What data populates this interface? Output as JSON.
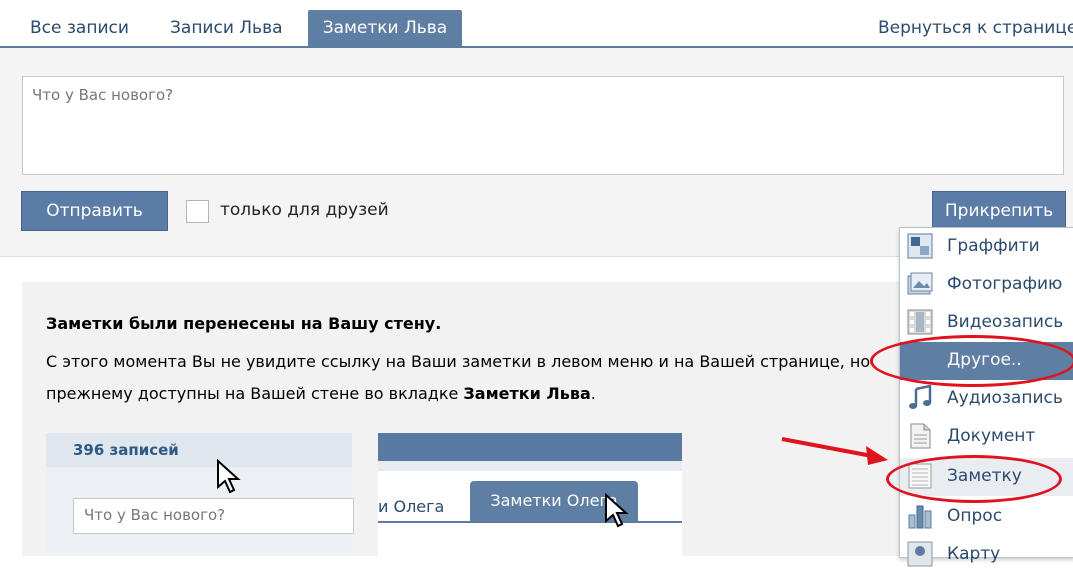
{
  "tabs": {
    "all": "Все записи",
    "lev": "Записи Льва",
    "notes": "Заметки Льва",
    "back": "Вернуться к странице"
  },
  "composer": {
    "placeholder": "Что у Вас нового?",
    "send": "Отправить",
    "friends_only": "только для друзей",
    "attach": "Прикрепить"
  },
  "notice": {
    "title": "Заметки были перенесены на Вашу стену.",
    "line1": "С этого момента Вы не увидите ссылку на Ваши заметки в левом меню и на Вашей странице, но",
    "line2_pre": "прежнему доступны на Вашей стене во вкладке ",
    "line2_bold": "Заметки Льва",
    "line2_post": "."
  },
  "shot1": {
    "count": "396 записей",
    "placeholder": "Что у Вас нового?"
  },
  "shot2": {
    "tab_partial": "и Олега",
    "tab_active": "Заметки Олега"
  },
  "menu": {
    "items": [
      {
        "label": "Граффити",
        "icon": "graffiti-icon"
      },
      {
        "label": "Фотографию",
        "icon": "photo-icon"
      },
      {
        "label": "Видеозапись",
        "icon": "video-icon"
      },
      {
        "label": "Другое..",
        "icon": ""
      },
      {
        "label": "Аудиозапись",
        "icon": "audio-icon"
      },
      {
        "label": "Документ",
        "icon": "document-icon"
      },
      {
        "label": "Заметку",
        "icon": "note-icon"
      },
      {
        "label": "Опрос",
        "icon": "poll-icon"
      },
      {
        "label": "Карту",
        "icon": "map-icon"
      }
    ]
  },
  "colors": {
    "accent": "#5f7ea3",
    "link": "#2b4a6e",
    "highlight": "#e0121d"
  }
}
